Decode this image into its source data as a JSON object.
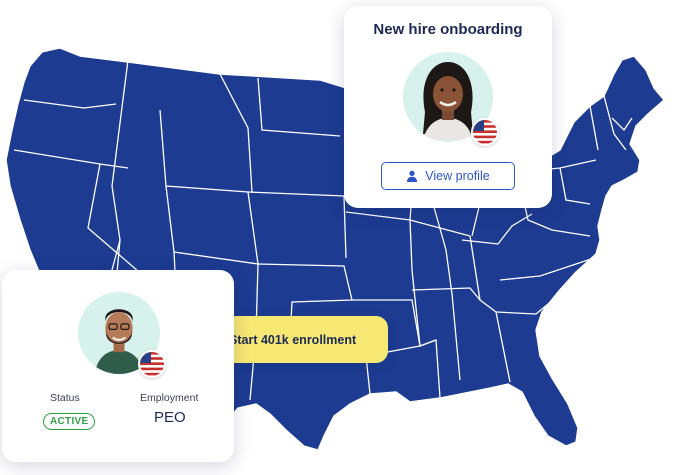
{
  "colors": {
    "map_fill": "#1c3b91",
    "map_border": "#ffffff",
    "accent_blue": "#2e55c4",
    "status_green": "#2f9e44",
    "pill_yellow": "#f7e873",
    "navy_text": "#1c2a55"
  },
  "onboarding_card": {
    "title": "New hire onboarding",
    "avatar_icon": "woman-avatar",
    "flag_icon": "us-flag-icon",
    "view_profile_icon": "person-icon",
    "view_profile_label": "View profile"
  },
  "enrollment_pill": {
    "icon": "document-icon",
    "label": "Start 401k enrollment"
  },
  "employee_card": {
    "avatar_icon": "man-avatar",
    "flag_icon": "us-flag-icon",
    "status_label": "Status",
    "status_value": "ACTIVE",
    "employment_label": "Employment",
    "employment_value": "PEO"
  }
}
